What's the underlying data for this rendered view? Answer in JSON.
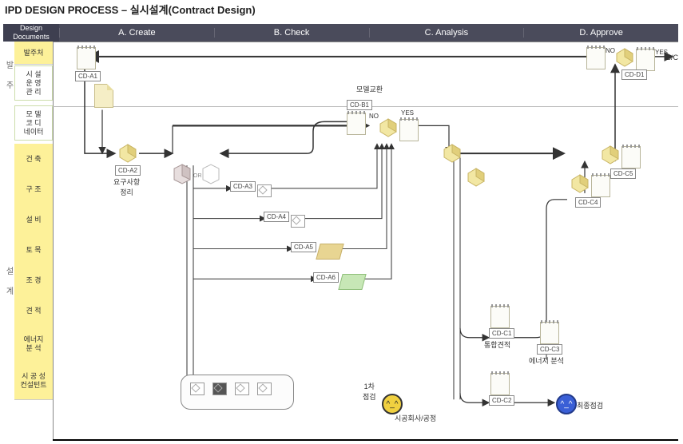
{
  "title": "IPD DESIGN PROCESS  – 실시설계(Contract Design)",
  "phases": {
    "dd_line1": "Design",
    "dd_line2": "Documents",
    "a": "A. Create",
    "b": "B. Check",
    "c": "C. Analysis",
    "d": "D. Approve"
  },
  "side": {
    "group_owner": "발  주",
    "group_design": "설  계",
    "lanes": [
      "발주처",
      "시 설\n운 영\n관 리",
      "모  델\n코  디\n네이터",
      "건  축",
      "구  조",
      "설  비",
      "토  목",
      "조  경",
      "견  적",
      "에너지\n분  석",
      "시 공 성\n컨설턴트"
    ]
  },
  "codes": {
    "a1": "CD-A1",
    "a2": "CD-A2",
    "a3": "CD-A3",
    "a4": "CD-A4",
    "a5": "CD-A5",
    "a6": "CD-A6",
    "b1": "CD-B1",
    "c1": "CD-C1",
    "c2": "CD-C2",
    "c3": "CD-C3",
    "c4": "CD-C4",
    "c5": "CD-C5",
    "d1": "CD-D1"
  },
  "labels": {
    "model_exchange": "모델교환",
    "requirements": "요구사항\n정리",
    "or": "OR",
    "no": "NO",
    "yes": "YES",
    "bc": "B/C",
    "first_check": "1차\n점검",
    "contractor": "시공회사/공정",
    "integrated_estimate": "통합견적",
    "energy_analysis": "에너지 분석",
    "final_check": "최종점검"
  }
}
